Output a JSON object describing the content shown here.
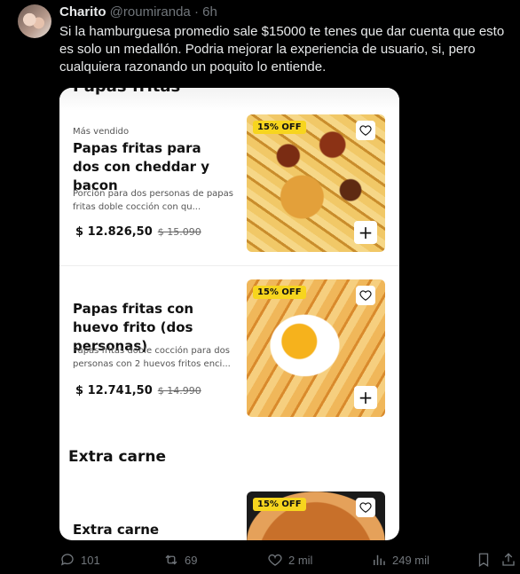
{
  "tweet": {
    "display_name": "Charito",
    "handle": "@roumiranda",
    "separator": " · ",
    "time": "6h",
    "text": "Si la hamburguesa promedio sale $15000 te tenes que dar cuenta que esto es solo un medallón.  Podria mejorar la experiencia de usuario, si, pero cualquiera razonando un poquito lo entiende."
  },
  "screenshot": {
    "cut_section_title": "Papas fritas",
    "products": [
      {
        "tag": "Más vendido",
        "title": "Papas fritas para dos con cheddar y bacon",
        "description": "Porción para dos personas de papas fritas doble cocción con qu...",
        "price": "$ 12.826,50",
        "old_price": "$ 15.090",
        "badge": "15% OFF"
      },
      {
        "tag": "",
        "title": "Papas fritas con huevo frito (dos personas)",
        "description": "Papas fritas doble cocción para dos personas con 2 huevos fritos enci...",
        "price": "$ 12.741,50",
        "old_price": "$ 14.990",
        "badge": "15% OFF"
      },
      {
        "tag": "",
        "title": "Extra carne",
        "description": "",
        "price": "",
        "old_price": "",
        "badge": "15% OFF"
      }
    ],
    "section_title": "Extra carne",
    "add_symbol": "+"
  },
  "actions": {
    "replies": "101",
    "retweets": "69",
    "likes": "2 mil",
    "views": "249 mil"
  },
  "icons": [
    "reply-icon",
    "retweet-icon",
    "like-icon",
    "views-icon",
    "bookmark-icon",
    "share-icon",
    "heart-outline-icon",
    "plus-icon"
  ],
  "colors": {
    "background": "#000000",
    "text": "#e7e9ea",
    "muted": "#71767b",
    "badge": "#f7d51e"
  }
}
